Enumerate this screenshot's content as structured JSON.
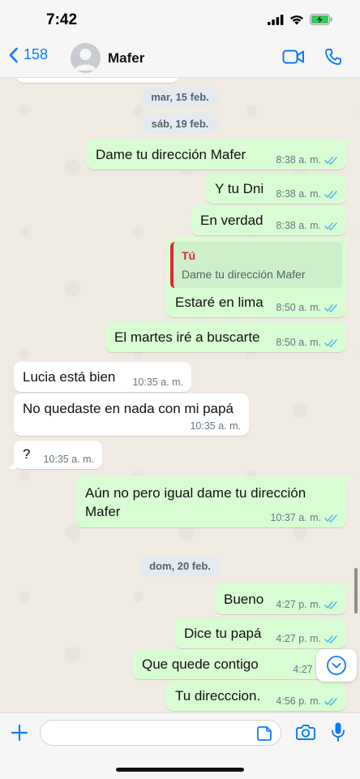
{
  "status_bar": {
    "time": "7:42"
  },
  "header": {
    "back_count": "158",
    "contact_name": "Mafer"
  },
  "dates": [
    "mar, 15 feb.",
    "sáb, 19 feb.",
    "dom, 20 feb."
  ],
  "messages": [
    {
      "text": "Dame tu dirección Mafer",
      "time": "8:38 a. m."
    },
    {
      "text": "Y tu Dni",
      "time": "8:38 a. m."
    },
    {
      "text": "En verdad",
      "time": "8:38 a. m."
    },
    {
      "quote_author": "Tú",
      "quote_text": "Dame tu dirección Mafer",
      "text": "Estaré en lima",
      "time": "8:50 a. m."
    },
    {
      "text": "El martes iré a buscarte",
      "time": "8:50 a. m."
    },
    {
      "text": "Lucia está bien",
      "time": "10:35 a. m."
    },
    {
      "text": "No quedaste en nada con mi papá",
      "time": "10:35 a. m."
    },
    {
      "text": "?",
      "time": "10:35 a. m."
    },
    {
      "text": "Aún  no pero igual dame tu dirección Mafer",
      "time": "10:37 a. m."
    },
    {
      "text": "Bueno",
      "time": "4:27 p. m."
    },
    {
      "text": "Dice tu papá",
      "time": "4:27 p. m."
    },
    {
      "text": "Que quede contigo",
      "time": "4:27 p. m."
    },
    {
      "text": "Tu direcccion.",
      "time": "4:56 p. m."
    }
  ],
  "colors": {
    "outgoing_bubble": "#d9fdd3",
    "incoming_bubble": "#ffffff",
    "chat_background": "#efeae2",
    "accent_blue": "#0a7cff",
    "read_tick": "#53bdeb",
    "quote_author": "#e0262f"
  },
  "icons": {
    "back": "chevron-left-icon",
    "avatar": "person-icon",
    "video": "video-call-icon",
    "phone": "phone-icon",
    "read": "double-check-icon",
    "scroll": "chevron-down-icon",
    "add": "plus-icon",
    "sticker": "sticker-icon",
    "camera": "camera-icon",
    "mic": "microphone-icon"
  }
}
